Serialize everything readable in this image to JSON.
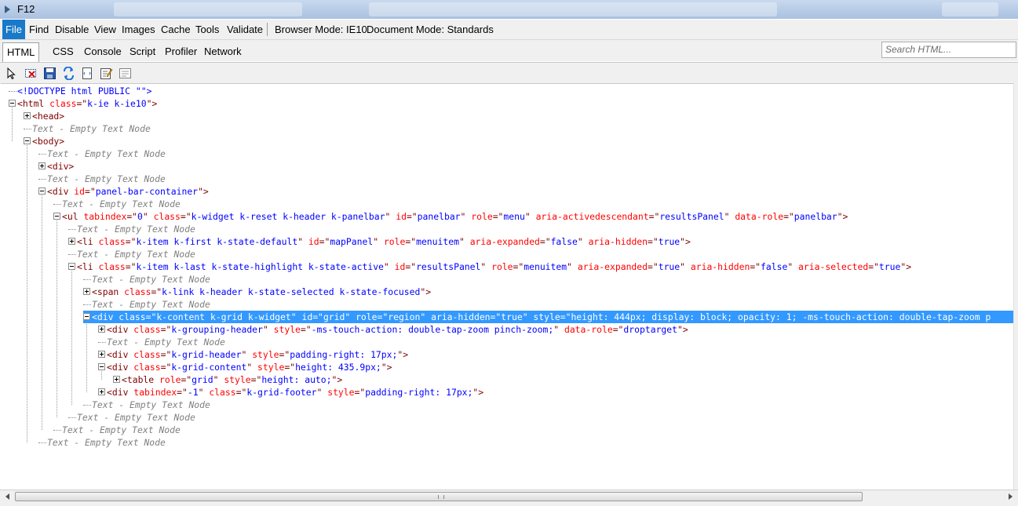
{
  "window": {
    "title": "F12"
  },
  "menu": {
    "items": [
      "File",
      "Find",
      "Disable",
      "View",
      "Images",
      "Cache",
      "Tools",
      "Validate"
    ],
    "browser_mode": "Browser Mode: IE10",
    "document_mode": "Document Mode: Standards"
  },
  "tabs": [
    "HTML",
    "CSS",
    "Console",
    "Script",
    "Profiler",
    "Network"
  ],
  "search": {
    "placeholder": "Search HTML..."
  },
  "toolbar": {
    "icons": [
      "select-element-icon",
      "clear-outline-icon",
      "save-icon",
      "refresh-icon",
      "word-wrap-icon",
      "edit-icon",
      "attributes-icon"
    ]
  },
  "tree": {
    "rows": [
      {
        "indent": 0,
        "toggle": "none",
        "sel": false,
        "parts": [
          [
            "pl",
            "<!DOCTYPE html PUBLIC \"\">"
          ]
        ]
      },
      {
        "indent": 0,
        "toggle": "minus",
        "sel": false,
        "parts": [
          [
            "tg",
            "<html "
          ],
          [
            "an",
            "class"
          ],
          [
            "tg",
            "=\""
          ],
          [
            "av",
            "k-ie k-ie10"
          ],
          [
            "tg",
            "\">"
          ]
        ]
      },
      {
        "indent": 1,
        "toggle": "plus",
        "sel": false,
        "parts": [
          [
            "tg",
            "<head>"
          ]
        ]
      },
      {
        "indent": 1,
        "toggle": "none",
        "sel": false,
        "parts": [
          [
            "tx",
            "Text - Empty Text Node"
          ]
        ]
      },
      {
        "indent": 1,
        "toggle": "minus",
        "sel": false,
        "parts": [
          [
            "tg",
            "<body>"
          ]
        ]
      },
      {
        "indent": 2,
        "toggle": "none",
        "sel": false,
        "parts": [
          [
            "tx",
            "Text - Empty Text Node"
          ]
        ]
      },
      {
        "indent": 2,
        "toggle": "plus",
        "sel": false,
        "parts": [
          [
            "tg",
            "<div>"
          ]
        ]
      },
      {
        "indent": 2,
        "toggle": "none",
        "sel": false,
        "parts": [
          [
            "tx",
            "Text - Empty Text Node"
          ]
        ]
      },
      {
        "indent": 2,
        "toggle": "minus",
        "sel": false,
        "parts": [
          [
            "tg",
            "<div "
          ],
          [
            "an",
            "id"
          ],
          [
            "tg",
            "=\""
          ],
          [
            "av",
            "panel-bar-container"
          ],
          [
            "tg",
            "\">"
          ]
        ]
      },
      {
        "indent": 3,
        "toggle": "none",
        "sel": false,
        "parts": [
          [
            "tx",
            "Text - Empty Text Node"
          ]
        ]
      },
      {
        "indent": 3,
        "toggle": "minus",
        "sel": false,
        "parts": [
          [
            "tg",
            "<ul "
          ],
          [
            "an",
            "tabindex"
          ],
          [
            "tg",
            "=\""
          ],
          [
            "av",
            "0"
          ],
          [
            "tg",
            "\" "
          ],
          [
            "an",
            "class"
          ],
          [
            "tg",
            "=\""
          ],
          [
            "av",
            "k-widget k-reset k-header k-panelbar"
          ],
          [
            "tg",
            "\" "
          ],
          [
            "an",
            "id"
          ],
          [
            "tg",
            "=\""
          ],
          [
            "av",
            "panelbar"
          ],
          [
            "tg",
            "\" "
          ],
          [
            "an",
            "role"
          ],
          [
            "tg",
            "=\""
          ],
          [
            "av",
            "menu"
          ],
          [
            "tg",
            "\" "
          ],
          [
            "an",
            "aria-activedescendant"
          ],
          [
            "tg",
            "=\""
          ],
          [
            "av",
            "resultsPanel"
          ],
          [
            "tg",
            "\" "
          ],
          [
            "an",
            "data-role"
          ],
          [
            "tg",
            "=\""
          ],
          [
            "av",
            "panelbar"
          ],
          [
            "tg",
            "\">"
          ]
        ]
      },
      {
        "indent": 4,
        "toggle": "none",
        "sel": false,
        "parts": [
          [
            "tx",
            "Text - Empty Text Node"
          ]
        ]
      },
      {
        "indent": 4,
        "toggle": "plus",
        "sel": false,
        "parts": [
          [
            "tg",
            "<li "
          ],
          [
            "an",
            "class"
          ],
          [
            "tg",
            "=\""
          ],
          [
            "av",
            "k-item k-first k-state-default"
          ],
          [
            "tg",
            "\" "
          ],
          [
            "an",
            "id"
          ],
          [
            "tg",
            "=\""
          ],
          [
            "av",
            "mapPanel"
          ],
          [
            "tg",
            "\" "
          ],
          [
            "an",
            "role"
          ],
          [
            "tg",
            "=\""
          ],
          [
            "av",
            "menuitem"
          ],
          [
            "tg",
            "\" "
          ],
          [
            "an",
            "aria-expanded"
          ],
          [
            "tg",
            "=\""
          ],
          [
            "av",
            "false"
          ],
          [
            "tg",
            "\" "
          ],
          [
            "an",
            "aria-hidden"
          ],
          [
            "tg",
            "=\""
          ],
          [
            "av",
            "true"
          ],
          [
            "tg",
            "\">"
          ]
        ]
      },
      {
        "indent": 4,
        "toggle": "none",
        "sel": false,
        "parts": [
          [
            "tx",
            "Text - Empty Text Node"
          ]
        ]
      },
      {
        "indent": 4,
        "toggle": "minus",
        "sel": false,
        "parts": [
          [
            "tg",
            "<li "
          ],
          [
            "an",
            "class"
          ],
          [
            "tg",
            "=\""
          ],
          [
            "av",
            "k-item k-last k-state-highlight k-state-active"
          ],
          [
            "tg",
            "\" "
          ],
          [
            "an",
            "id"
          ],
          [
            "tg",
            "=\""
          ],
          [
            "av",
            "resultsPanel"
          ],
          [
            "tg",
            "\" "
          ],
          [
            "an",
            "role"
          ],
          [
            "tg",
            "=\""
          ],
          [
            "av",
            "menuitem"
          ],
          [
            "tg",
            "\" "
          ],
          [
            "an",
            "aria-expanded"
          ],
          [
            "tg",
            "=\""
          ],
          [
            "av",
            "true"
          ],
          [
            "tg",
            "\" "
          ],
          [
            "an",
            "aria-hidden"
          ],
          [
            "tg",
            "=\""
          ],
          [
            "av",
            "false"
          ],
          [
            "tg",
            "\" "
          ],
          [
            "an",
            "aria-selected"
          ],
          [
            "tg",
            "=\""
          ],
          [
            "av",
            "true"
          ],
          [
            "tg",
            "\">"
          ]
        ]
      },
      {
        "indent": 5,
        "toggle": "none",
        "sel": false,
        "parts": [
          [
            "tx",
            "Text - Empty Text Node"
          ]
        ]
      },
      {
        "indent": 5,
        "toggle": "plus",
        "sel": false,
        "parts": [
          [
            "tg",
            "<span "
          ],
          [
            "an",
            "class"
          ],
          [
            "tg",
            "=\""
          ],
          [
            "av",
            "k-link k-header k-state-selected k-state-focused"
          ],
          [
            "tg",
            "\">"
          ]
        ]
      },
      {
        "indent": 5,
        "toggle": "none",
        "sel": false,
        "parts": [
          [
            "tx",
            "Text - Empty Text Node"
          ]
        ]
      },
      {
        "indent": 5,
        "toggle": "minus",
        "sel": true,
        "parts": [
          [
            "tg",
            "<div "
          ],
          [
            "an",
            "class"
          ],
          [
            "tg",
            "=\""
          ],
          [
            "av",
            "k-content k-grid k-widget"
          ],
          [
            "tg",
            "\" "
          ],
          [
            "an",
            "id"
          ],
          [
            "tg",
            "=\""
          ],
          [
            "av",
            "grid"
          ],
          [
            "tg",
            "\" "
          ],
          [
            "an",
            "role"
          ],
          [
            "tg",
            "=\""
          ],
          [
            "av",
            "region"
          ],
          [
            "tg",
            "\" "
          ],
          [
            "an",
            "aria-hidden"
          ],
          [
            "tg",
            "=\""
          ],
          [
            "av",
            "true"
          ],
          [
            "tg",
            "\" "
          ],
          [
            "an",
            "style"
          ],
          [
            "tg",
            "=\""
          ],
          [
            "av",
            "height: 444px; display: block; opacity: 1; -ms-touch-action: double-tap-zoom p"
          ]
        ]
      },
      {
        "indent": 6,
        "toggle": "plus",
        "sel": false,
        "parts": [
          [
            "tg",
            "<div "
          ],
          [
            "an",
            "class"
          ],
          [
            "tg",
            "=\""
          ],
          [
            "av",
            "k-grouping-header"
          ],
          [
            "tg",
            "\" "
          ],
          [
            "an",
            "style"
          ],
          [
            "tg",
            "=\""
          ],
          [
            "av",
            "-ms-touch-action: double-tap-zoom pinch-zoom;"
          ],
          [
            "tg",
            "\" "
          ],
          [
            "an",
            "data-role"
          ],
          [
            "tg",
            "=\""
          ],
          [
            "av",
            "droptarget"
          ],
          [
            "tg",
            "\">"
          ]
        ]
      },
      {
        "indent": 6,
        "toggle": "none",
        "sel": false,
        "parts": [
          [
            "tx",
            "Text - Empty Text Node"
          ]
        ]
      },
      {
        "indent": 6,
        "toggle": "plus",
        "sel": false,
        "parts": [
          [
            "tg",
            "<div "
          ],
          [
            "an",
            "class"
          ],
          [
            "tg",
            "=\""
          ],
          [
            "av",
            "k-grid-header"
          ],
          [
            "tg",
            "\" "
          ],
          [
            "an",
            "style"
          ],
          [
            "tg",
            "=\""
          ],
          [
            "av",
            "padding-right: 17px;"
          ],
          [
            "tg",
            "\">"
          ]
        ]
      },
      {
        "indent": 6,
        "toggle": "minus",
        "sel": false,
        "parts": [
          [
            "tg",
            "<div "
          ],
          [
            "an",
            "class"
          ],
          [
            "tg",
            "=\""
          ],
          [
            "av",
            "k-grid-content"
          ],
          [
            "tg",
            "\" "
          ],
          [
            "an",
            "style"
          ],
          [
            "tg",
            "=\""
          ],
          [
            "av",
            "height: 435.9px;"
          ],
          [
            "tg",
            "\">"
          ]
        ]
      },
      {
        "indent": 7,
        "toggle": "plus",
        "sel": false,
        "parts": [
          [
            "tg",
            "<table "
          ],
          [
            "an",
            "role"
          ],
          [
            "tg",
            "=\""
          ],
          [
            "av",
            "grid"
          ],
          [
            "tg",
            "\" "
          ],
          [
            "an",
            "style"
          ],
          [
            "tg",
            "=\""
          ],
          [
            "av",
            "height: auto;"
          ],
          [
            "tg",
            "\">"
          ]
        ]
      },
      {
        "indent": 6,
        "toggle": "plus",
        "sel": false,
        "parts": [
          [
            "tg",
            "<div "
          ],
          [
            "an",
            "tabindex"
          ],
          [
            "tg",
            "=\""
          ],
          [
            "av",
            "-1"
          ],
          [
            "tg",
            "\" "
          ],
          [
            "an",
            "class"
          ],
          [
            "tg",
            "=\""
          ],
          [
            "av",
            "k-grid-footer"
          ],
          [
            "tg",
            "\" "
          ],
          [
            "an",
            "style"
          ],
          [
            "tg",
            "=\""
          ],
          [
            "av",
            "padding-right: 17px;"
          ],
          [
            "tg",
            "\">"
          ]
        ]
      },
      {
        "indent": 5,
        "toggle": "none",
        "sel": false,
        "parts": [
          [
            "tx",
            "Text - Empty Text Node"
          ]
        ]
      },
      {
        "indent": 4,
        "toggle": "none",
        "sel": false,
        "parts": [
          [
            "tx",
            "Text - Empty Text Node"
          ]
        ]
      },
      {
        "indent": 3,
        "toggle": "none",
        "sel": false,
        "parts": [
          [
            "tx",
            "Text - Empty Text Node"
          ]
        ]
      },
      {
        "indent": 2,
        "toggle": "none",
        "sel": false,
        "parts": [
          [
            "tx",
            "Text - Empty Text Node"
          ]
        ]
      }
    ]
  },
  "colors": {
    "tag": "#800000",
    "attr_name": "#ff0000",
    "attr_value": "#0000ff",
    "text_node": "#808080",
    "selection": "#3399ff",
    "menu_active": "#1979ca"
  }
}
